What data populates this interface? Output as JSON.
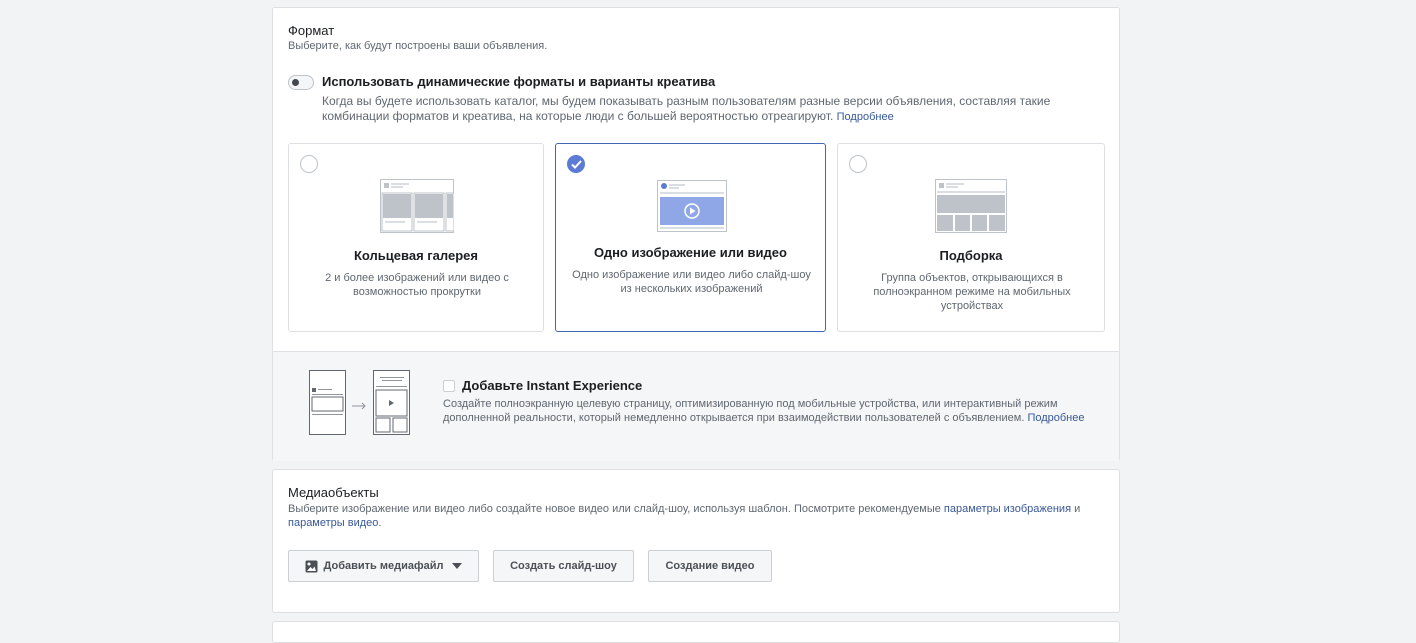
{
  "format": {
    "title": "Формат",
    "subtitle": "Выберите, как будут построены ваши объявления.",
    "dynamic": {
      "label": "Использовать динамические форматы и варианты креатива",
      "enabled": false,
      "description": "Когда вы будете использовать каталог, мы будем показывать разным пользователям разные версии объявления, составляя такие комбинации форматов и креатива, на которые люди с большей вероятностью отреагируют.",
      "link": "Подробнее"
    },
    "options": [
      {
        "title": "Кольцевая галерея",
        "description": "2 и более изображений или видео с возможностью прокрутки",
        "selected": false,
        "icon": "carousel-icon"
      },
      {
        "title": "Одно изображение или видео",
        "description": "Одно изображение или видео либо слайд-шоу из нескольких изображений",
        "selected": true,
        "icon": "single-image-video-icon"
      },
      {
        "title": "Подборка",
        "description": "Группа объектов, открывающихся в полноэкранном режиме на мобильных устройствах",
        "selected": false,
        "icon": "collection-icon"
      }
    ],
    "instant_experience": {
      "label": "Добавьте Instant Experience",
      "checked": false,
      "description": "Создайте полноэкранную целевую страницу, оптимизированную под мобильные устройства, или интерактивный режим дополненной реальности, который немедленно открывается при взаимодействии пользователей с объявлением.",
      "link": "Подробнее"
    }
  },
  "media": {
    "title": "Медиаобъекты",
    "description_start": "Выберите изображение или видео либо создайте новое видео или слайд-шоу, используя шаблон. Посмотрите рекомендуемые",
    "image_params_link": "параметры изображения",
    "and": "и",
    "video_params_link": "параметры видео",
    "period": ".",
    "buttons": {
      "add_media": "Добавить медиафайл",
      "slideshow": "Создать слайд-шоу",
      "video": "Создание видео"
    }
  },
  "colors": {
    "accent": "#4267b2",
    "check": "#5b7bd5",
    "link": "#385898"
  }
}
